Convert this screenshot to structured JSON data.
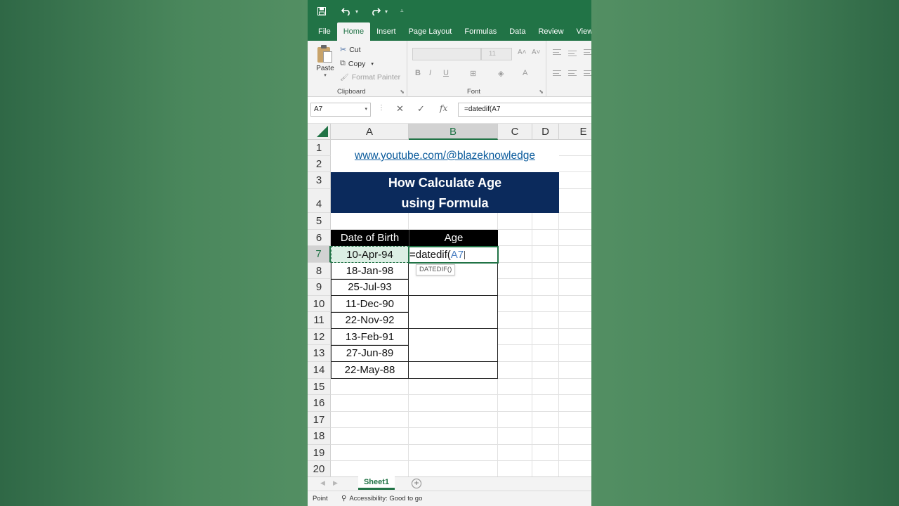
{
  "quick_access": {
    "save_icon": "save-icon",
    "undo_icon": "undo-icon",
    "redo_icon": "redo-icon"
  },
  "tabs": [
    "File",
    "Home",
    "Insert",
    "Page Layout",
    "Formulas",
    "Data",
    "Review",
    "View"
  ],
  "active_tab": "Home",
  "clipboard": {
    "paste_label": "Paste",
    "cut_label": "Cut",
    "copy_label": "Copy",
    "format_painter_label": "Format Painter",
    "group_label": "Clipboard"
  },
  "font": {
    "size_value": "11",
    "group_label": "Font",
    "bold": "B",
    "italic": "I",
    "underline": "U"
  },
  "formula_bar": {
    "name_box": "A7",
    "formula": "=datedif(A7"
  },
  "columns": [
    "A",
    "B",
    "C",
    "D",
    "E"
  ],
  "rows": [
    "1",
    "2",
    "3",
    "4",
    "5",
    "6",
    "7",
    "8",
    "9",
    "10",
    "11",
    "12",
    "13",
    "14",
    "15",
    "16",
    "17",
    "18",
    "19",
    "20"
  ],
  "sheet": {
    "link": "www.youtube.com/@blazeknowledge",
    "title_line1": "How Calculate Age",
    "title_line2": "using Formula",
    "header_dob": "Date of Birth",
    "header_age": "Age",
    "dates": [
      "10-Apr-94",
      "18-Jan-98",
      "25-Jul-93",
      "11-Dec-90",
      "22-Nov-92",
      "13-Feb-91",
      "27-Jun-89",
      "22-May-88"
    ],
    "editing_prefix": "=datedif(",
    "editing_ref": "A7",
    "tooltip": "DATEDIF()"
  },
  "sheet_tab": "Sheet1",
  "status": {
    "mode": "Point",
    "accessibility": "Accessibility: Good to go"
  },
  "colors": {
    "excel_green": "#217346",
    "banner_navy": "#0b2a5c",
    "link_blue": "#0b5b9c"
  }
}
